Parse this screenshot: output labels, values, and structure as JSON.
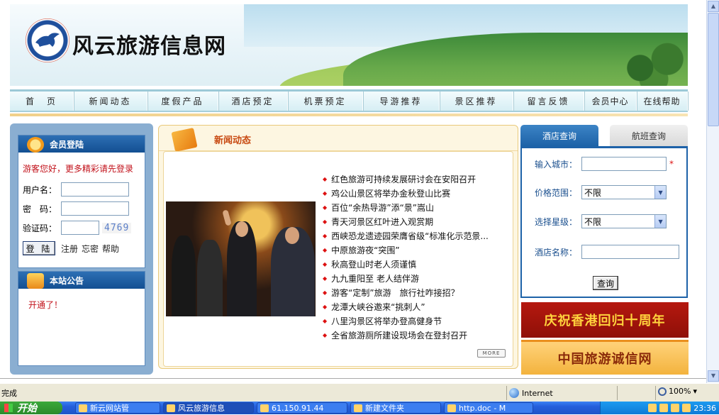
{
  "site": {
    "title": "风云旅游信息网"
  },
  "nav": {
    "items": [
      "首　页",
      "新闻动态",
      "度假产品",
      "酒店预定",
      "机票预定",
      "导游推荐",
      "景区推荐",
      "留言反馈",
      "会员中心",
      "在线帮助"
    ]
  },
  "login": {
    "header": "会员登陆",
    "tip": "游客您好，更多精彩请先登录",
    "username_label": "用户名：",
    "password_label": "密　码：",
    "captcha_label": "验证码：",
    "captcha_text": "4769",
    "login_button": "登 陆",
    "register_link": "注册",
    "forgot_link": "忘密",
    "help_link": "帮助"
  },
  "notice": {
    "header": "本站公告",
    "text": "开通了！"
  },
  "news": {
    "header": "新闻动态",
    "items": [
      "红色旅游可持续发展研讨会在安阳召开",
      "鸡公山景区将举办金秋登山比赛",
      "百位“余热导游”添“景”嵩山",
      "青天河景区红叶进入观赏期",
      "西峡恐龙遗迹园荣膺省级“标准化示范景...",
      "中原旅游夜“突围”",
      "秋高登山时老人须谨慎",
      "九九重阳至 老人结伴游",
      "游客“定制”旅游　旅行社咋接招？",
      "龙潭大峡谷邀来“挑刺人”",
      "八里沟景区将举办登高健身节",
      "全省旅游厕所建设现场会在登封召开"
    ],
    "more_label": "MORE"
  },
  "query": {
    "tab_hotel": "酒店查询",
    "tab_flight": "航班查询",
    "city_label": "输入城市：",
    "required_mark": "*",
    "price_label": "价格范围：",
    "price_value": "不限",
    "star_label": "选择星级：",
    "star_value": "不限",
    "hotel_name_label": "酒店名称：",
    "submit_label": "查询"
  },
  "banners": {
    "hk": "庆祝香港回归十周年",
    "credit": "中国旅游诚信网"
  },
  "statusbar": {
    "text": "完成",
    "zone": "Internet",
    "zoom": "100%"
  },
  "taskbar": {
    "start": "开始",
    "tasks": [
      "新云网站管",
      "风云旅游信息",
      "61.150.91.44",
      "新建文件夹",
      "http.doc - M"
    ],
    "clock": "23:36"
  },
  "colors": {
    "accent_blue": "#1d62a8",
    "news_title": "#c84a12",
    "alert_red": "#c2121b"
  }
}
